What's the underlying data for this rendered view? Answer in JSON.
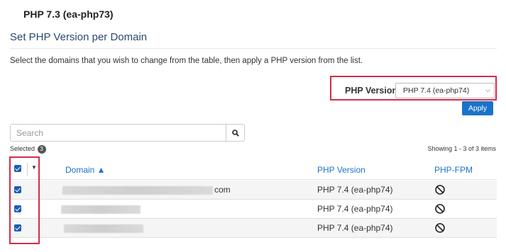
{
  "header": {
    "title": "PHP 7.3 (ea-php73)",
    "section_title": "Set PHP Version per Domain",
    "instructions": "Select the domains that you wish to change from the table, then apply a PHP version from the list."
  },
  "version_picker": {
    "label": "PHP Version",
    "selected": "PHP 7.4 (ea-php74)",
    "apply_label": "Apply"
  },
  "search": {
    "placeholder": "Search",
    "selected_label": "Selected",
    "selected_count": "3",
    "showing": "Showing 1 - 3 of 3 items"
  },
  "table": {
    "columns": {
      "domain": "Domain ▲",
      "php_version": "PHP Version",
      "php_fpm": "PHP-FPM"
    },
    "rows": [
      {
        "domain_suffix": "com",
        "php_version": "PHP 7.4 (ea-php74)",
        "fpm_icon": "no-entry-icon",
        "checked": true
      },
      {
        "domain_suffix": "",
        "php_version": "PHP 7.4 (ea-php74)",
        "fpm_icon": "no-entry-icon",
        "checked": true
      },
      {
        "domain_suffix": "",
        "php_version": "PHP 7.4 (ea-php74)",
        "fpm_icon": "no-entry-icon",
        "checked": true
      }
    ]
  },
  "colors": {
    "highlight": "#d62b4b",
    "primary": "#1a73c9",
    "checkbox": "#1a5fb4"
  }
}
